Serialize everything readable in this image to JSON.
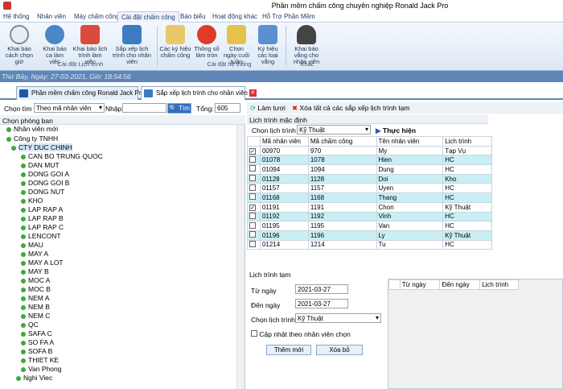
{
  "window": {
    "title": "Phần mềm chấm công chuyên nghiệp Ronald Jack Pro"
  },
  "menu": [
    "Hệ thống",
    "Nhân viên",
    "Máy chấm công",
    "Cài đặt chấm công",
    "Báo biểu",
    "Hoạt động khác",
    "Hỗ Trợ Phần Mềm"
  ],
  "menu_active": "Cài đặt chấm công",
  "ribbon": {
    "buttons": [
      {
        "label": "Khai báo cách chọn giờ"
      },
      {
        "label": "Khai báo ca làm việc"
      },
      {
        "label": "Khai báo lịch trình làm việc"
      },
      {
        "label": "Sắp xếp lịch trình cho nhân viên"
      },
      {
        "label": "Các ký hiệu chấm công"
      },
      {
        "label": "Thông số làm tròn"
      },
      {
        "label": "Chọn ngày cuối tuần"
      },
      {
        "label": "Ký hiệu các loại vắng"
      },
      {
        "label": "Khai báo vắng cho nhân viên"
      }
    ],
    "groups": [
      "Cài đặt Lịch trình",
      "Cài đặt hệ thống",
      "Khác"
    ]
  },
  "status": {
    "datetime": "Thứ Bảy, Ngày: 27-03-2021, Giờ: 18:54:56"
  },
  "doc_tabs": [
    "Phần mềm chấm công Ronald Jack Pro",
    "Sắp xếp lịch trình cho nhân viên"
  ],
  "left": {
    "choose_label": "Chọn tìm",
    "choose_value": "Theo mã nhân viên",
    "input_label": "Nhập",
    "search_button": "Tìm",
    "total_label": "Tổng:",
    "total_value": "605",
    "dept_header": "Chọn phòng ban",
    "tree": {
      "root1": "Nhân viên mới",
      "root2": "Công ty TNHH",
      "company": "CTY DUC CHINH",
      "departments": [
        "CAN BO TRUNG QUOC",
        "DAN MUT",
        "DONG GOI A",
        "DONG GOI B",
        "DONG NUT",
        "KHO",
        "LAP RAP A",
        "LAP RAP B",
        "LAP RAP C",
        "LENCONT",
        "MAU",
        "MAY A",
        "MAY A LOT",
        "MAY B",
        "MOC A",
        "MOC B",
        "NEM A",
        "NEM B",
        "NEM C",
        "QC",
        "SAFA C",
        "SO FA A",
        "SOFA B",
        "THIET KE",
        "Van Phong"
      ],
      "last": "Nghi Viec"
    }
  },
  "right": {
    "refresh_button": "Làm tươi",
    "delete_all_button": "Xóa tất cả các sắp xếp lịch trình tạm",
    "default_schedule_header": "Lịch trình mặc định",
    "choose_schedule_label": "Chọn lịch trình",
    "choose_schedule_value": "Kỹ Thuật",
    "execute_button": "Thực hiện",
    "grid": {
      "columns": [
        "Mã nhân viên",
        "Mã chấm công",
        "Tên nhân viên",
        "Lịch trình"
      ],
      "rows": [
        {
          "checked": true,
          "emp": "00970",
          "code": "970",
          "name": "My",
          "sched": "Tạp Vụ"
        },
        {
          "checked": false,
          "emp": "01078",
          "code": "1078",
          "name": "Hien",
          "sched": "HC"
        },
        {
          "checked": false,
          "emp": "01094",
          "code": "1094",
          "name": "Dung",
          "sched": "HC"
        },
        {
          "checked": false,
          "emp": "01128",
          "code": "1128",
          "name": "Doi",
          "sched": "Kho"
        },
        {
          "checked": false,
          "emp": "01157",
          "code": "1157",
          "name": "Uyen",
          "sched": "HC"
        },
        {
          "checked": false,
          "emp": "01168",
          "code": "1168",
          "name": "Thang",
          "sched": "HC"
        },
        {
          "checked": true,
          "emp": "01191",
          "code": "1191",
          "name": "Chon",
          "sched": "Kỹ Thuật"
        },
        {
          "checked": false,
          "emp": "01192",
          "code": "1192",
          "name": "Vinh",
          "sched": "HC"
        },
        {
          "checked": false,
          "emp": "01195",
          "code": "1195",
          "name": "Van",
          "sched": "HC"
        },
        {
          "checked": false,
          "emp": "01196",
          "code": "1196",
          "name": "Ly",
          "sched": "Kỹ Thuật"
        },
        {
          "checked": false,
          "emp": "01214",
          "code": "1214",
          "name": "Tu",
          "sched": "HC"
        }
      ]
    },
    "temp": {
      "header": "Lịch trình tạm",
      "from_label": "Từ ngày",
      "from_value": "2021-03-27",
      "to_label": "Đến ngày",
      "to_value": "2021-03-27",
      "sched_label": "Chọn lịch trình",
      "sched_value": "Kỹ Thuật",
      "update_label": "Cập nhật theo nhân viên chọn",
      "add_button": "Thêm mới",
      "delete_button": "Xóa bỏ",
      "columns": [
        "Từ ngày",
        "Đến ngày",
        "Lịch trình"
      ]
    }
  }
}
